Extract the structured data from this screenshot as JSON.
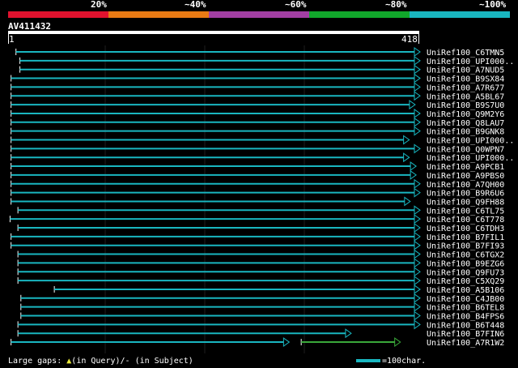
{
  "header": {
    "percent_labels": [
      "20%",
      "~40%",
      "~60%",
      "~80%",
      "~100%"
    ],
    "scale_colors": [
      "#e0122e",
      "#e87a14",
      "#a23fa3",
      "#11a72b",
      "#19b6c0"
    ]
  },
  "query": {
    "name": "AV411432",
    "start": "1",
    "end": "418",
    "length": 418
  },
  "hit_color": "#19b6c0",
  "gap_color": "#3aa83a",
  "hits": [
    {
      "label": "UniRef100_C6TMN5",
      "qstart": 8,
      "qend": 418,
      "arrow": "right"
    },
    {
      "label": "UniRef100_UPI000..",
      "qstart": 12,
      "qend": 418,
      "arrow": "right"
    },
    {
      "label": "UniRef100_A7NUD5",
      "qstart": 12,
      "qend": 418,
      "arrow": "right"
    },
    {
      "label": "UniRef100_B9SX84",
      "qstart": 3,
      "qend": 418,
      "arrow": "right"
    },
    {
      "label": "UniRef100_A7R677",
      "qstart": 3,
      "qend": 418,
      "arrow": "right"
    },
    {
      "label": "UniRef100_A5BL67",
      "qstart": 3,
      "qend": 418,
      "arrow": "right"
    },
    {
      "label": "UniRef100_B9S7U0",
      "qstart": 3,
      "qend": 413,
      "arrow": "right"
    },
    {
      "label": "UniRef100_Q9M2Y6",
      "qstart": 3,
      "qend": 418,
      "arrow": "right"
    },
    {
      "label": "UniRef100_Q8LAU7",
      "qstart": 3,
      "qend": 418,
      "arrow": "right"
    },
    {
      "label": "UniRef100_B9GNK8",
      "qstart": 3,
      "qend": 418,
      "arrow": "right"
    },
    {
      "label": "UniRef100_UPI000..",
      "qstart": 3,
      "qend": 407,
      "arrow": "right"
    },
    {
      "label": "UniRef100_Q0WPN7",
      "qstart": 3,
      "qend": 418,
      "arrow": "right"
    },
    {
      "label": "UniRef100_UPI000..",
      "qstart": 3,
      "qend": 407,
      "arrow": "right"
    },
    {
      "label": "UniRef100_A9PCB1",
      "qstart": 3,
      "qend": 414,
      "arrow": "right"
    },
    {
      "label": "UniRef100_A9PBS0",
      "qstart": 3,
      "qend": 414,
      "arrow": "right"
    },
    {
      "label": "UniRef100_A7QH00",
      "qstart": 3,
      "qend": 418,
      "arrow": "right"
    },
    {
      "label": "UniRef100_B9R6U6",
      "qstart": 3,
      "qend": 418,
      "arrow": "right"
    },
    {
      "label": "UniRef100_Q9FH88",
      "qstart": 3,
      "qend": 408,
      "arrow": "right"
    },
    {
      "label": "UniRef100_C6TL75",
      "qstart": 10,
      "qend": 418,
      "arrow": "right"
    },
    {
      "label": "UniRef100_C6T778",
      "qstart": 2,
      "qend": 418,
      "arrow": "right"
    },
    {
      "label": "UniRef100_C6TDH3",
      "qstart": 10,
      "qend": 418,
      "arrow": "right"
    },
    {
      "label": "UniRef100_B7FIL1",
      "qstart": 3,
      "qend": 418,
      "arrow": "right"
    },
    {
      "label": "UniRef100_B7FI93",
      "qstart": 3,
      "qend": 418,
      "arrow": "right"
    },
    {
      "label": "UniRef100_C6TGX2",
      "qstart": 10,
      "qend": 418,
      "arrow": "right"
    },
    {
      "label": "UniRef100_B9EZG6",
      "qstart": 10,
      "qend": 418,
      "arrow": "right"
    },
    {
      "label": "UniRef100_Q9FU73",
      "qstart": 10,
      "qend": 418,
      "arrow": "right"
    },
    {
      "label": "UniRef100_C5XQ29",
      "qstart": 10,
      "qend": 418,
      "arrow": "right"
    },
    {
      "label": "UniRef100_A5B106",
      "qstart": 47,
      "qend": 418,
      "arrow": "right"
    },
    {
      "label": "UniRef100_C4JB00",
      "qstart": 13,
      "qend": 418,
      "arrow": "right"
    },
    {
      "label": "UniRef100_B6TEL8",
      "qstart": 13,
      "qend": 418,
      "arrow": "right"
    },
    {
      "label": "UniRef100_B4FPS6",
      "qstart": 13,
      "qend": 418,
      "arrow": "right"
    },
    {
      "label": "UniRef100_B6T448",
      "qstart": 10,
      "qend": 418,
      "arrow": "right"
    },
    {
      "label": "UniRef100_B7FIN6",
      "qstart": 10,
      "qend": 348,
      "arrow": "right"
    },
    {
      "label": "UniRef100_A7R1W2",
      "qstart": 3,
      "qend": 285,
      "arrow": "right",
      "gap_to": 298,
      "second_start": 298,
      "second_end": 398,
      "second_color": "#3aa83a"
    }
  ],
  "footer": {
    "gaps_label": "Large gaps:",
    "query_gap": "(in Query)/",
    "subject_gap": "- (in Subject)",
    "scale_label": "=100char."
  }
}
